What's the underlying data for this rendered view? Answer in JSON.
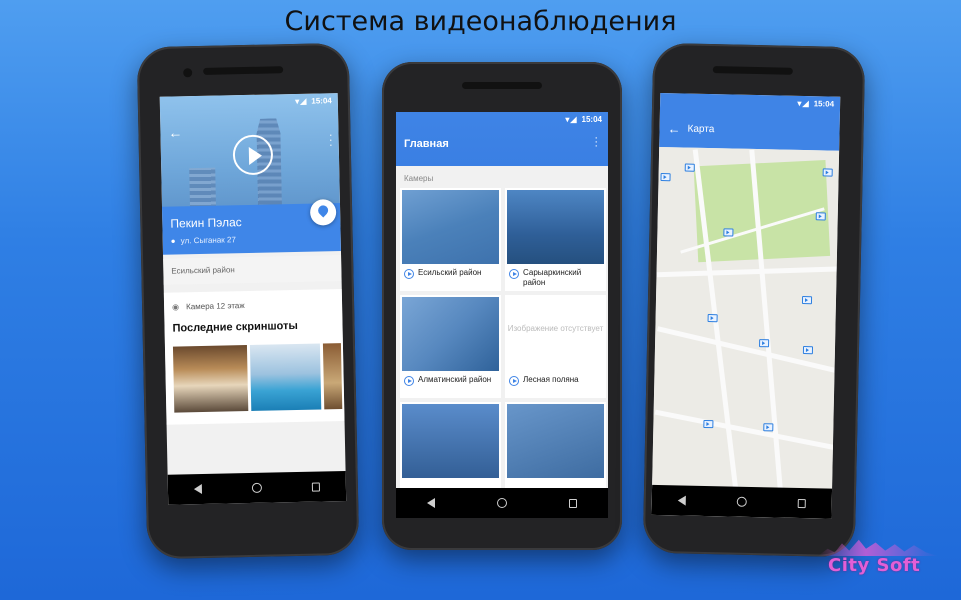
{
  "slide": {
    "title": "Система видеонаблюдения"
  },
  "status_bar": {
    "time": "15:04"
  },
  "phone1": {
    "place_name": "Пекин Пэлас",
    "place_address": "ул. Сыганак 27",
    "district": "Есильский район",
    "camera_label": "Камера 12 этаж",
    "screenshots_title": "Последние скриншоты"
  },
  "phone2": {
    "app_title": "Главная",
    "section_label": "Камеры",
    "cameras": [
      {
        "label": "Есильский район"
      },
      {
        "label": "Сарыаркинский район"
      },
      {
        "label": "Алматинский район"
      },
      {
        "label": "Лесная поляна",
        "placeholder": "Изображение отсутствует"
      },
      {
        "label": ""
      },
      {
        "label": ""
      }
    ]
  },
  "phone3": {
    "app_title": "Карта"
  },
  "logo": {
    "text": "City Soft"
  },
  "icons": {
    "back": "arrow-back-icon",
    "more": "more-vert-icon",
    "play": "play-circle-icon",
    "location": "location-pin-icon",
    "camera": "camera-icon",
    "nav_back": "nav-back-icon",
    "nav_home": "nav-home-icon",
    "nav_recent": "nav-recent-icon"
  },
  "colors": {
    "accent": "#3f84e6",
    "background": "#2f7fe4"
  }
}
